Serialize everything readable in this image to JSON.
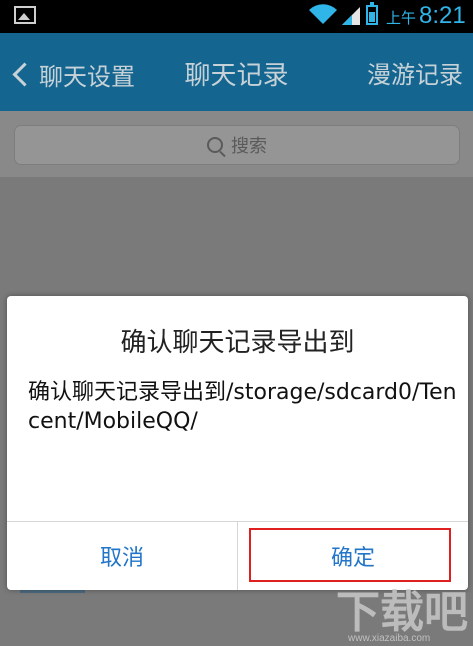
{
  "status_bar": {
    "ampm": "上午",
    "time": "8:21"
  },
  "header": {
    "back_label": "聊天设置",
    "title": "聊天记录",
    "right_label": "漫游记录"
  },
  "search": {
    "placeholder": "搜索"
  },
  "dialog": {
    "title": "确认聊天记录导出到",
    "message": "确认聊天记录导出到/storage/sdcard0/Tencent/MobileQQ/",
    "cancel_label": "取消",
    "confirm_label": "确定"
  },
  "watermark": {
    "text": "www.xiazaiba.com"
  },
  "colors": {
    "header_bg": "#14658f",
    "accent_blue": "#2275c8",
    "highlight_red": "#e0201f",
    "status_blue": "#2fb5e8"
  }
}
